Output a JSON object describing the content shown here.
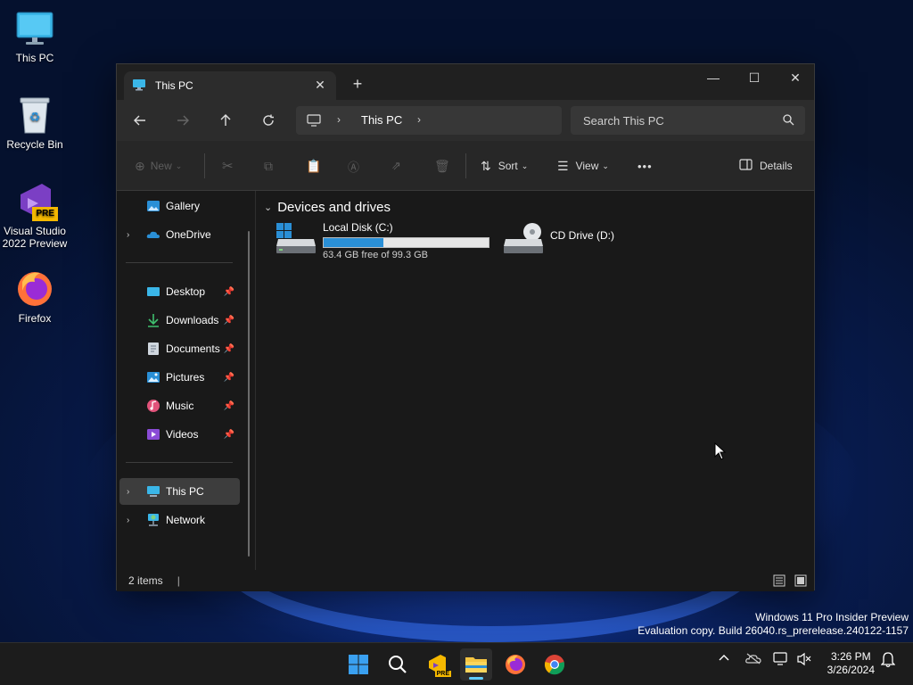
{
  "desktop": {
    "icons": [
      {
        "label": "This PC"
      },
      {
        "label": "Recycle Bin"
      },
      {
        "label": "Visual Studio 2022 Preview"
      },
      {
        "label": "Firefox"
      }
    ],
    "vs_badge": "PRE"
  },
  "window": {
    "tab_title": "This PC",
    "controls": {
      "minimize": "—",
      "maximize": "☐",
      "close": "✕"
    },
    "address": {
      "segments": [
        "This PC"
      ]
    },
    "search": {
      "placeholder": "Search This PC"
    },
    "toolbar": {
      "new_label": "New",
      "sort_label": "Sort",
      "view_label": "View",
      "more_label": "•••",
      "details_label": "Details"
    },
    "sidebar": {
      "top": [
        {
          "label": "Gallery"
        },
        {
          "label": "OneDrive"
        }
      ],
      "quick": [
        {
          "label": "Desktop"
        },
        {
          "label": "Downloads"
        },
        {
          "label": "Documents"
        },
        {
          "label": "Pictures"
        },
        {
          "label": "Music"
        },
        {
          "label": "Videos"
        }
      ],
      "bottom": [
        {
          "label": "This PC"
        },
        {
          "label": "Network"
        }
      ]
    },
    "content": {
      "group_title": "Devices and drives",
      "drives": [
        {
          "name": "Local Disk (C:)",
          "free_text": "63.4 GB free of 99.3 GB",
          "used_fraction": 0.36
        },
        {
          "name": "CD Drive (D:)"
        }
      ]
    },
    "status": {
      "items": "2 items"
    }
  },
  "watermark": {
    "line1": "Windows 11 Pro Insider Preview",
    "line2": "Evaluation copy. Build 26040.rs_prerelease.240122-1157"
  },
  "taskbar": {
    "time": "3:26 PM",
    "date": "3/26/2024",
    "vs_badge": "PRE"
  },
  "colors": {
    "accent": "#60cdff",
    "progress": "#2a8fd6",
    "window_bg": "#191919"
  }
}
